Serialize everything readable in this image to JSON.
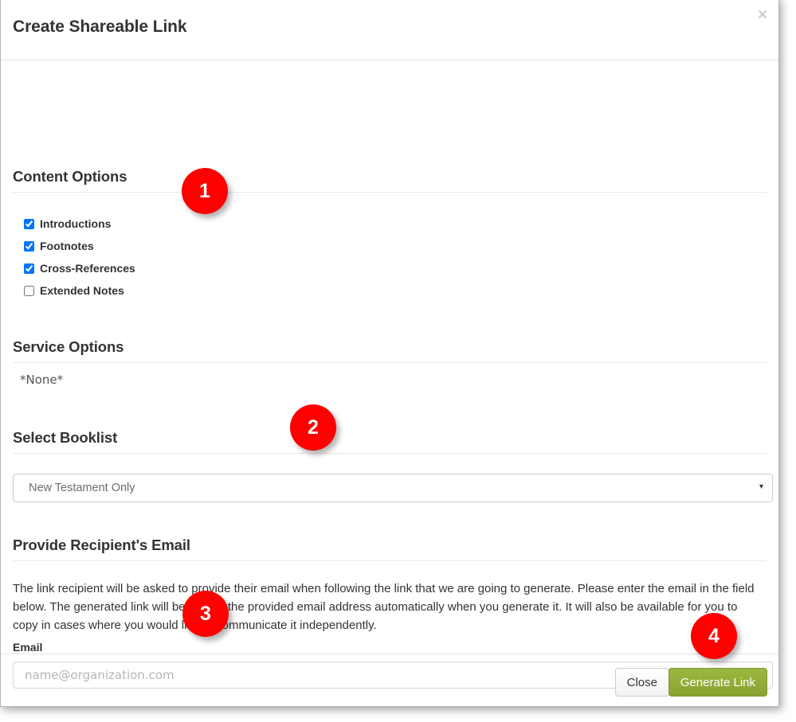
{
  "modal": {
    "title": "Create Shareable Link",
    "close_icon": "close-icon",
    "close_glyph": "×"
  },
  "content_options": {
    "heading": "Content Options",
    "items": [
      {
        "label": "Introductions",
        "checked": true
      },
      {
        "label": "Footnotes",
        "checked": true
      },
      {
        "label": "Cross-References",
        "checked": true
      },
      {
        "label": "Extended Notes",
        "checked": false
      }
    ]
  },
  "service_options": {
    "heading": "Service Options",
    "value": "*None*"
  },
  "select_booklist": {
    "heading": "Select Booklist",
    "selected": "New Testament Only",
    "caret_glyph": "▾"
  },
  "email_section": {
    "heading": "Provide Recipient's Email",
    "description": "The link recipient will be asked to provide their email when following the link that we are going to generate. Please enter the email in the field below. The generated link will be sent to the provided email address automatically when you generate it. It will also be available for you to copy in cases where you would like to communicate it independently.",
    "field_label": "Email",
    "placeholder": "name@organization.com",
    "value": ""
  },
  "footer": {
    "close_label": "Close",
    "generate_label": "Generate Link"
  },
  "annotations": [
    {
      "number": "1"
    },
    {
      "number": "2"
    },
    {
      "number": "3"
    },
    {
      "number": "4"
    }
  ],
  "colors": {
    "accent_green": "#8CA832",
    "badge_red": "#FF0000",
    "text": "#333333",
    "rule": "#E8E8E8"
  }
}
